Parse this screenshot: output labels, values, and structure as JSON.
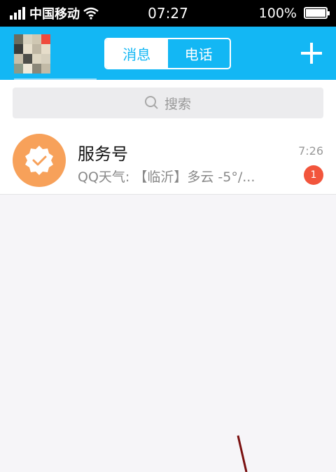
{
  "status_bar": {
    "carrier": "中国移动",
    "time": "07:27",
    "battery": "100%",
    "battery_level": 1.0,
    "icons": [
      "signal-icon",
      "wifi-icon",
      "battery-icon"
    ]
  },
  "header": {
    "tabs": [
      {
        "label": "消息",
        "active": true
      },
      {
        "label": "电话",
        "active": false
      }
    ],
    "add_icon": "plus-icon",
    "accent_color": "#13b7f4"
  },
  "search": {
    "placeholder": "搜索",
    "icon": "search-icon"
  },
  "conversations": [
    {
      "title": "服务号",
      "preview": "QQ天气: 【临沂】多云 -5°/...",
      "time": "7:26",
      "badge": "1",
      "avatar_icon": "verified-badge-icon",
      "avatar_color": "#f7a15a"
    }
  ]
}
